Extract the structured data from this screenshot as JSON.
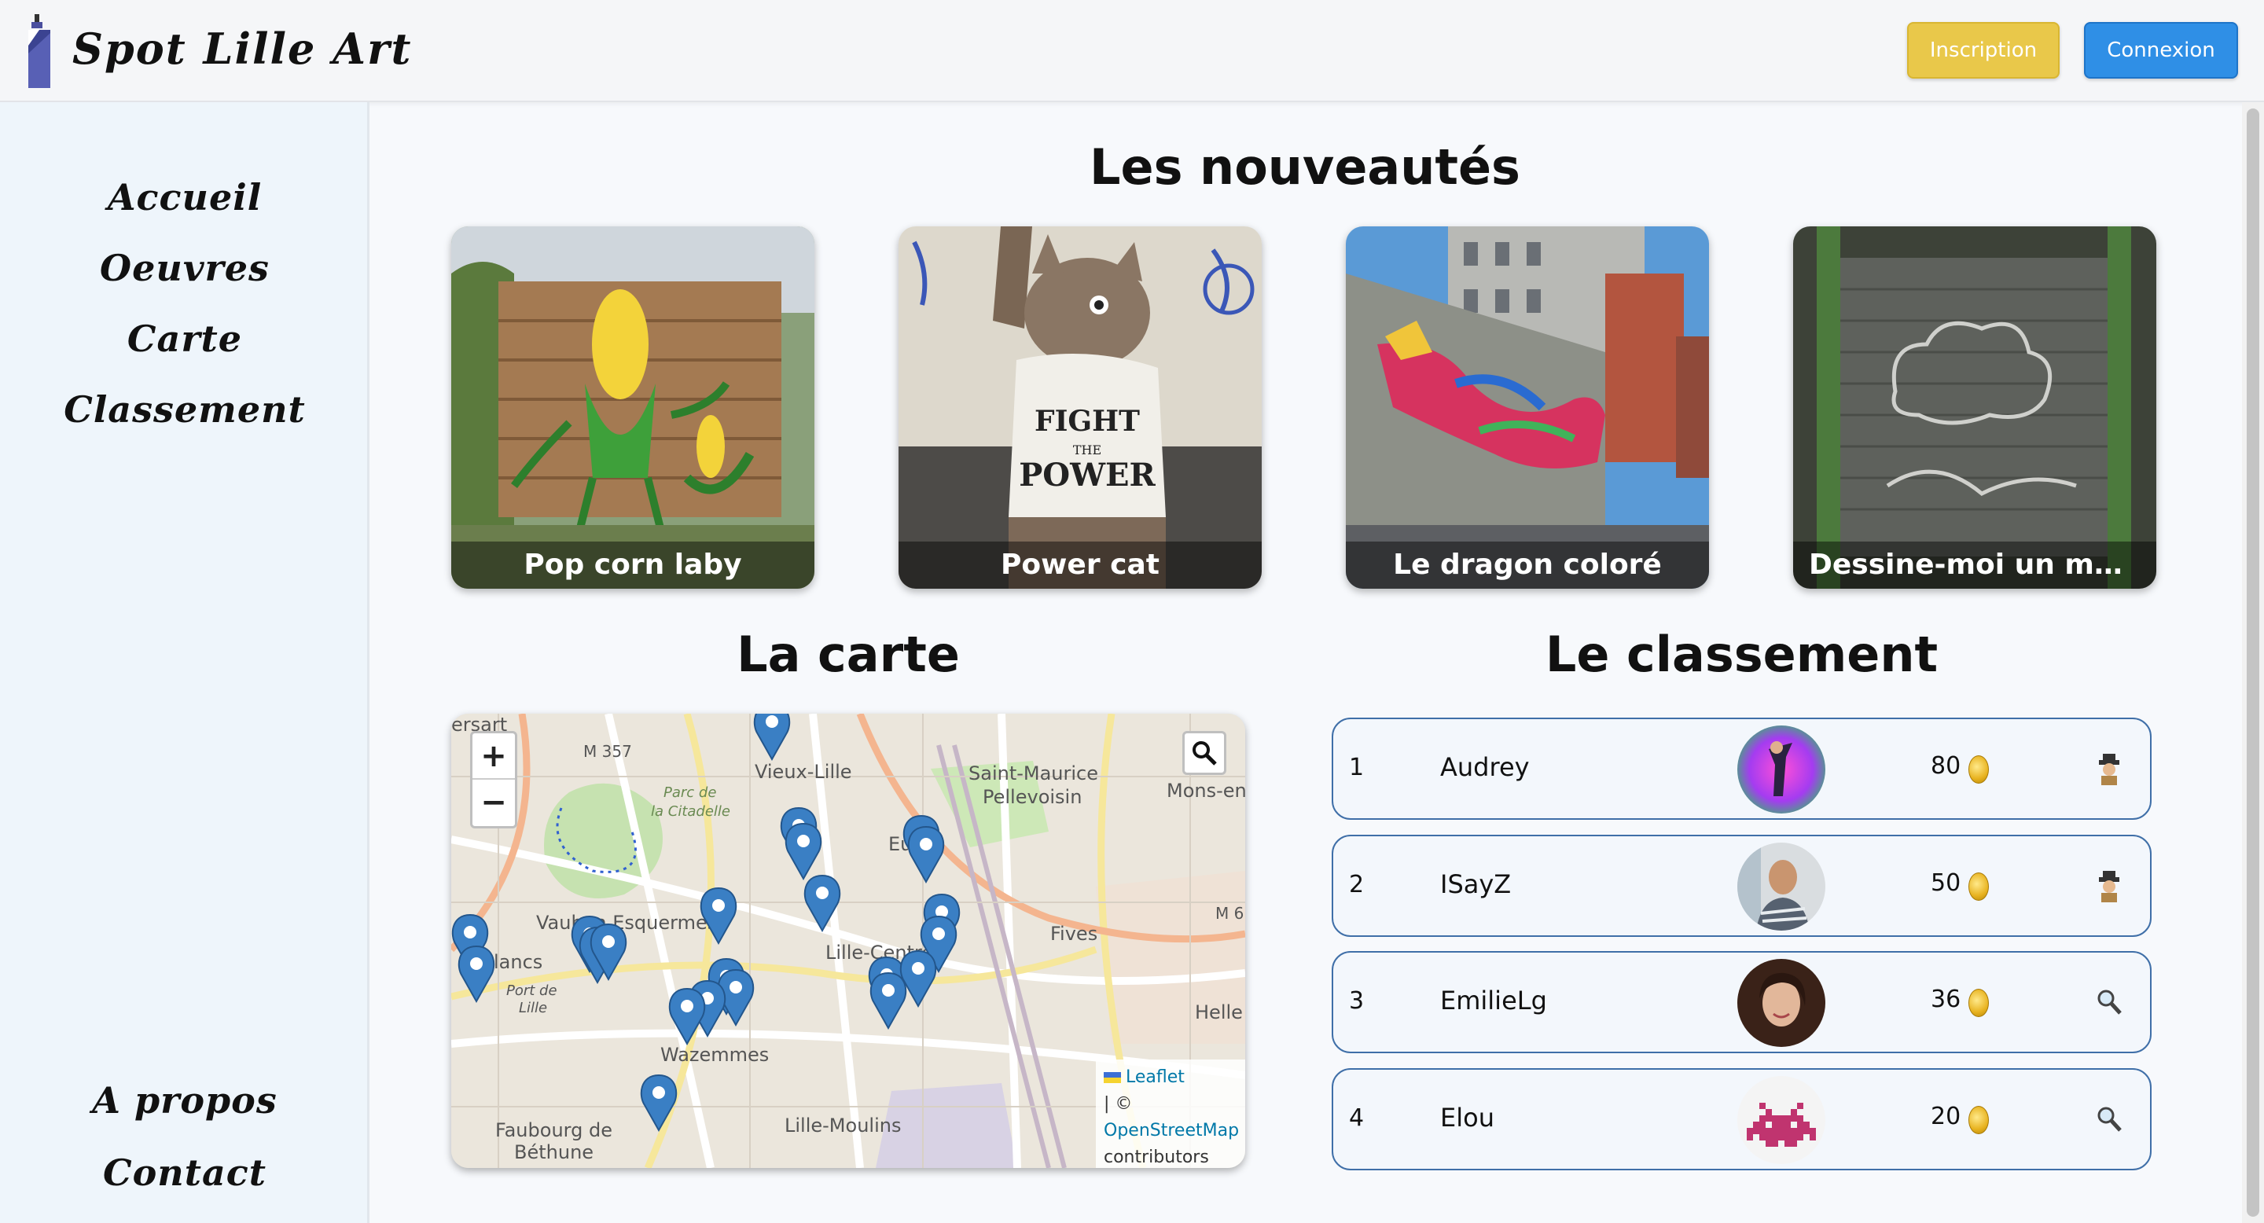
{
  "header": {
    "brand": "Spot Lille Art",
    "signup_label": "Inscription",
    "login_label": "Connexion"
  },
  "sidebar": {
    "items": [
      {
        "label": "Accueil"
      },
      {
        "label": "Oeuvres"
      },
      {
        "label": "Carte"
      },
      {
        "label": "Classement"
      }
    ],
    "bottom_items": [
      {
        "label": "A propos"
      },
      {
        "label": "Contact"
      }
    ]
  },
  "news": {
    "title": "Les nouveautés",
    "cards": [
      {
        "caption": "Pop corn laby"
      },
      {
        "caption": "Power cat"
      },
      {
        "caption": "Le dragon coloré"
      },
      {
        "caption": "Dessine-moi un mouton"
      }
    ]
  },
  "map": {
    "title": "La carte",
    "zoom_in": "+",
    "zoom_out": "−",
    "attribution_leaflet": "Leaflet",
    "attribution_sep": "| ©",
    "attribution_osm": "OpenStreetMap",
    "attribution_contrib": "contributors",
    "labels": {
      "vieux_lille": "Vieux-Lille",
      "saint_maurice": "Saint-Maurice",
      "pellevoisin": "Pellevoisin",
      "mons": "Mons-en",
      "parc": "Parc de",
      "citadelle": "la Citadelle",
      "vauban": "Vauban Esquermes",
      "lille_centre": "Lille-Centre",
      "fives": "Fives",
      "wazemmes": "Wazemmes",
      "hellemmes": "Helle",
      "lille_moulins": "Lille-Moulins",
      "faubourg": "Faubourg de",
      "bethune": "Béthune",
      "port": "Port de",
      "port2": "Lille",
      "lancs": "lancs",
      "ersart": "ersart",
      "m357": "M 357",
      "m6": "M 6",
      "eu": "Eu"
    }
  },
  "ranking": {
    "title": "Le classement",
    "rows": [
      {
        "position": "1",
        "name": "Audrey",
        "score": "80",
        "badge": "detective-icon"
      },
      {
        "position": "2",
        "name": "ISayZ",
        "score": "50",
        "badge": "detective-icon"
      },
      {
        "position": "3",
        "name": "EmilieLg",
        "score": "36",
        "badge": "magnifier-icon"
      },
      {
        "position": "4",
        "name": "Elou",
        "score": "20",
        "badge": "magnifier-icon"
      }
    ]
  },
  "colors": {
    "signup": "#e9c84a",
    "login": "#2f8fe6",
    "rank_border": "#3f6fa8",
    "marker": "#3a7fc4"
  }
}
